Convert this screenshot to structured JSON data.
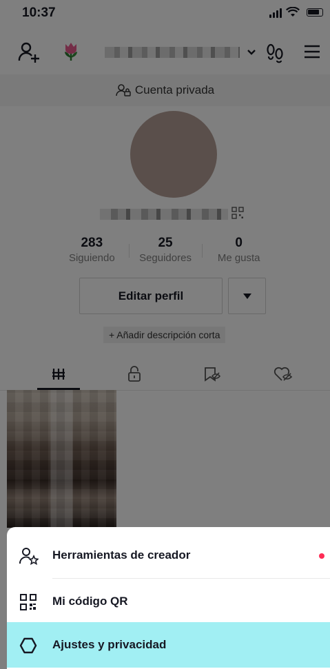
{
  "status_bar": {
    "time": "10:37"
  },
  "profile": {
    "private_label": "Cuenta privada",
    "stats": [
      {
        "value": "283",
        "label": "Siguiendo"
      },
      {
        "value": "25",
        "label": "Seguidores"
      },
      {
        "value": "0",
        "label": "Me gusta"
      }
    ],
    "edit_profile_label": "Editar perfil",
    "add_description_label": "+ Añadir descripción corta"
  },
  "sheet": {
    "items": [
      {
        "label": "Herramientas de creador",
        "icon": "creator-tools-icon"
      },
      {
        "label": "Mi código QR",
        "icon": "qr-code-icon"
      },
      {
        "label": "Ajustes y privacidad",
        "icon": "settings-icon"
      }
    ],
    "highlight_color": "#a1eff3",
    "notification_dot_color": "#fe2c55"
  }
}
